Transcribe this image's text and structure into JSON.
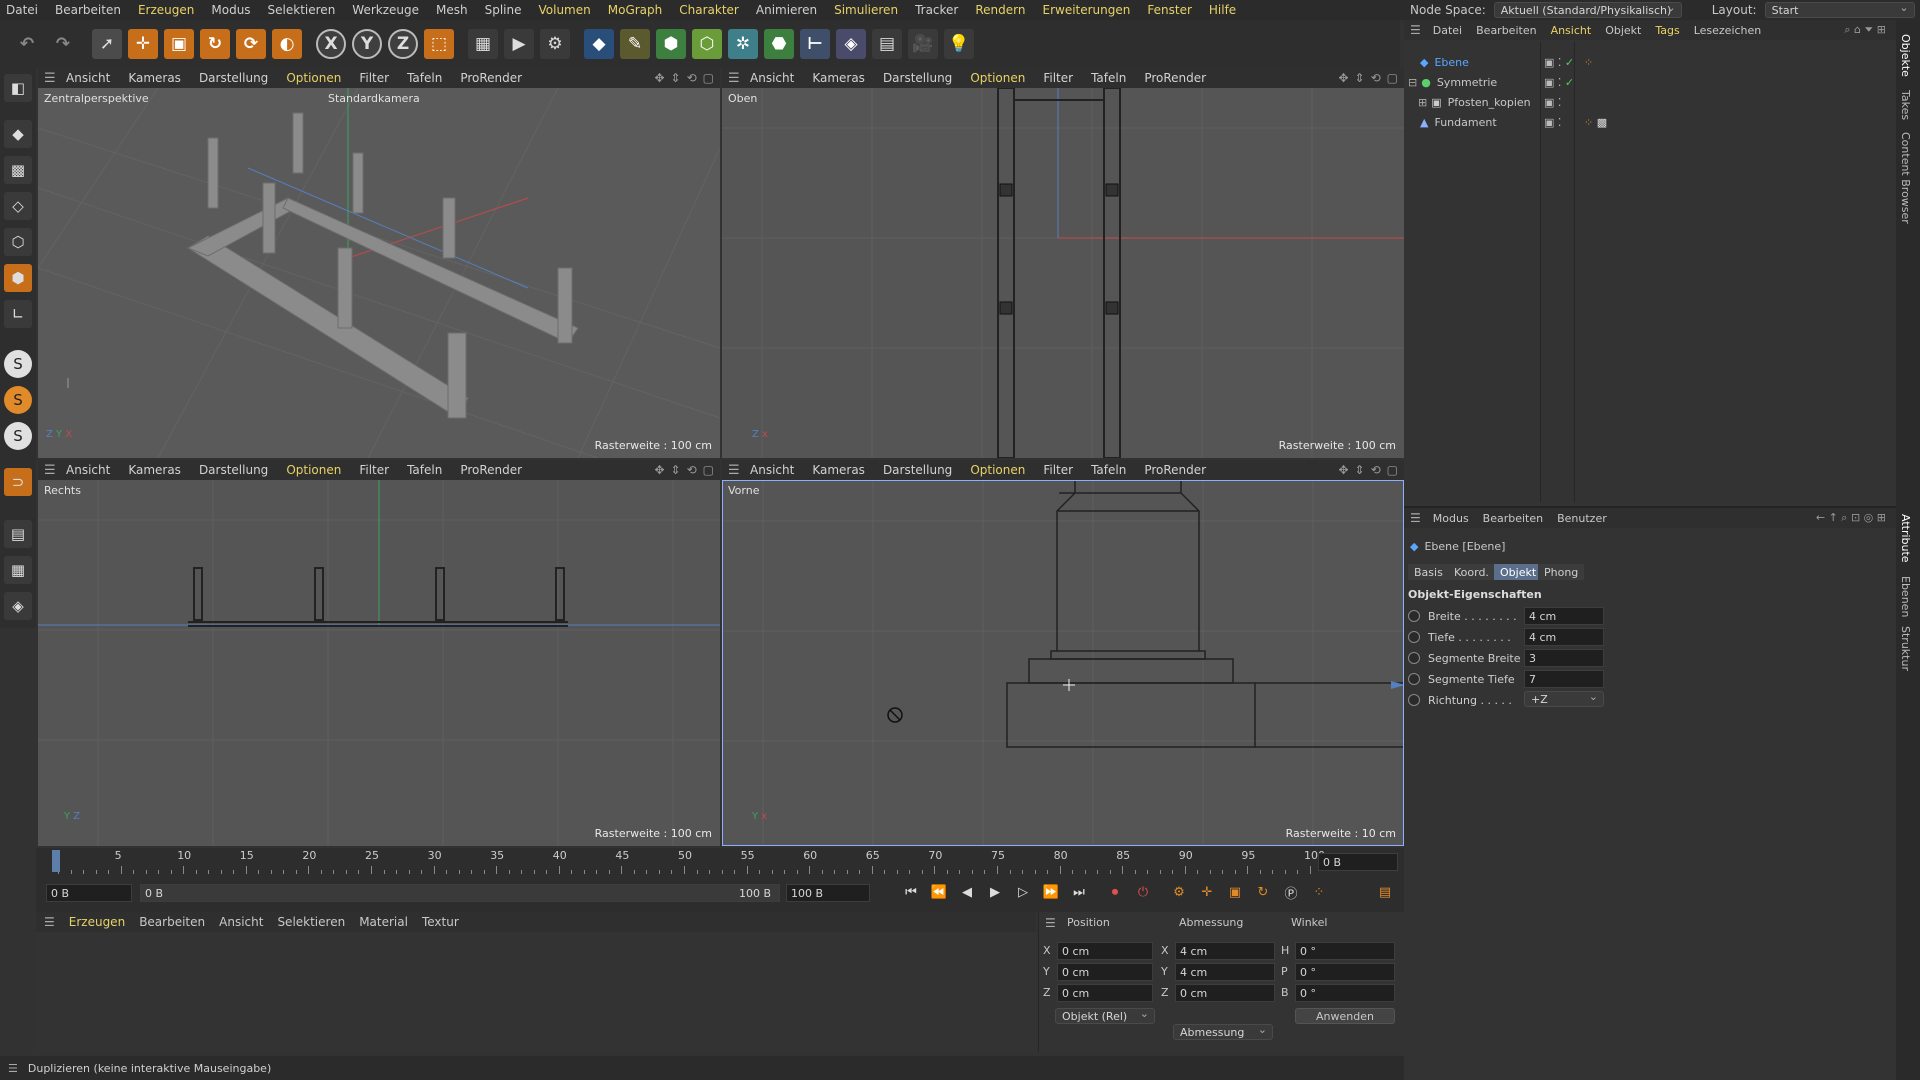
{
  "menu": {
    "items": [
      "Datei",
      "Bearbeiten",
      "Erzeugen",
      "Modus",
      "Selektieren",
      "Werkzeuge",
      "Mesh",
      "Spline",
      "Volumen",
      "MoGraph",
      "Charakter",
      "Animieren",
      "Simulieren",
      "Tracker",
      "Rendern",
      "Erweiterungen",
      "Fenster",
      "Hilfe"
    ]
  },
  "nodespace": {
    "label": "Node Space:",
    "value": "Aktuell (Standard/Physikalisch)",
    "layout_label": "Layout:",
    "layout_value": "Start"
  },
  "toolbar": {
    "undo": "↶",
    "redo": "↷",
    "select": "➚",
    "move": "✛",
    "scale": "▣",
    "rotate": "↻",
    "x": "X",
    "y": "Y",
    "z": "Z",
    "coord": "⬚",
    "render_region": "🎞",
    "render": "▶",
    "render_settings": "⚙"
  },
  "viewports": {
    "menu": [
      "Ansicht",
      "Kameras",
      "Darstellung",
      "Optionen",
      "Filter",
      "Tafeln",
      "ProRender"
    ],
    "topleft": {
      "label": "Zentralperspektive",
      "camera": "Standardkamera",
      "raster": "Rasterweite : 100 cm"
    },
    "topright": {
      "label": "Oben",
      "raster": "Rasterweite : 100 cm"
    },
    "bottomleft": {
      "label": "Rechts",
      "raster": "Rasterweite : 100 cm"
    },
    "bottomright": {
      "label": "Vorne",
      "raster": "Rasterweite : 10 cm"
    }
  },
  "timeline": {
    "ticks": [
      "0",
      "5",
      "10",
      "15",
      "20",
      "25",
      "30",
      "35",
      "40",
      "45",
      "50",
      "55",
      "60",
      "65",
      "70",
      "75",
      "80",
      "85",
      "90",
      "95",
      "100"
    ],
    "current": "0 B",
    "start": "0 B",
    "range_start": "0 B",
    "range_end": "100 B",
    "end": "100 B"
  },
  "material_panel": {
    "menu": [
      "Erzeugen",
      "Bearbeiten",
      "Ansicht",
      "Selektieren",
      "Material",
      "Textur"
    ]
  },
  "coords": {
    "headers": [
      "Position",
      "Abmessung",
      "Winkel"
    ],
    "rows": [
      {
        "axis": "X",
        "pos": "0 cm",
        "dim_axis": "X",
        "dim": "4 cm",
        "ang_axis": "H",
        "ang": "0 °"
      },
      {
        "axis": "Y",
        "pos": "0 cm",
        "dim_axis": "Y",
        "dim": "4 cm",
        "ang_axis": "P",
        "ang": "0 °"
      },
      {
        "axis": "Z",
        "pos": "0 cm",
        "dim_axis": "Z",
        "dim": "0 cm",
        "ang_axis": "B",
        "ang": "0 °"
      }
    ],
    "mode": "Objekt (Rel)",
    "size_mode": "Abmessung",
    "apply": "Anwenden"
  },
  "status": "Duplizieren (keine interaktive Mauseingabe)",
  "objects": {
    "menu": [
      "Datei",
      "Bearbeiten",
      "Ansicht",
      "Objekt",
      "Tags",
      "Lesezeichen"
    ],
    "items": [
      {
        "name": "Ebene",
        "selected": true
      },
      {
        "name": "Symmetrie",
        "selected": false
      },
      {
        "name": "Pfosten_kopien",
        "selected": false
      },
      {
        "name": "Fundament",
        "selected": false
      }
    ]
  },
  "attributes": {
    "menu": [
      "Modus",
      "Bearbeiten",
      "Benutzer"
    ],
    "title": "Ebene [Ebene]",
    "tabs": [
      "Basis",
      "Koord.",
      "Objekt",
      "Phong"
    ],
    "active_tab": "Objekt",
    "section": "Objekt-Eigenschaften",
    "props": [
      {
        "label": "Breite . . . . . . . .",
        "value": "4 cm"
      },
      {
        "label": "Tiefe . . . . . . . .",
        "value": "4 cm"
      },
      {
        "label": "Segmente Breite",
        "value": "3"
      },
      {
        "label": "Segmente Tiefe",
        "value": "7"
      },
      {
        "label": "Richtung . . . . .",
        "value": "+Z"
      }
    ]
  },
  "right_tabs": [
    "Objekte",
    "Takes",
    "Content Browser",
    "Attribute",
    "Ebenen",
    "Struktur"
  ],
  "colors": {
    "accent": "#e8d266",
    "selected_obj": "#5ba6ff",
    "viewport_bg": "#555555"
  }
}
